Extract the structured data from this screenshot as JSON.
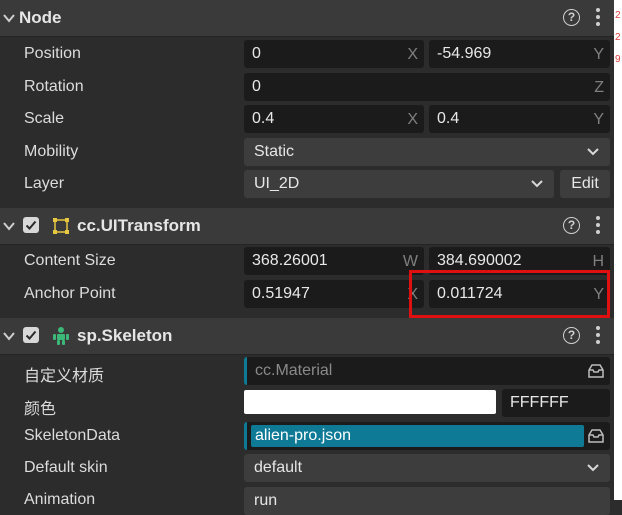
{
  "node": {
    "title": "Node",
    "rows": {
      "position": {
        "label": "Position",
        "x": "0",
        "x_axis": "X",
        "y": "-54.969",
        "y_axis": "Y"
      },
      "rotation": {
        "label": "Rotation",
        "value": "0",
        "axis": "Z"
      },
      "scale": {
        "label": "Scale",
        "x": "0.4",
        "x_axis": "X",
        "y": "0.4",
        "y_axis": "Y"
      },
      "mobility": {
        "label": "Mobility",
        "value": "Static"
      },
      "layer": {
        "label": "Layer",
        "value": "UI_2D",
        "edit_label": "Edit"
      }
    }
  },
  "uitransform": {
    "title": "cc.UITransform",
    "enabled": true,
    "rows": {
      "content_size": {
        "label": "Content Size",
        "w": "368.26001",
        "w_axis": "W",
        "h": "384.690002",
        "h_axis": "H"
      },
      "anchor_point": {
        "label": "Anchor Point",
        "x": "0.51947",
        "x_axis": "X",
        "y": "0.011724",
        "y_axis": "Y"
      }
    }
  },
  "skeleton": {
    "title": "sp.Skeleton",
    "enabled": true,
    "rows": {
      "material": {
        "label": "自定义材质",
        "placeholder": "cc.Material"
      },
      "color": {
        "label": "颜色",
        "hex": "FFFFFF",
        "swatch": "#ffffff"
      },
      "skeleton_data": {
        "label": "SkeletonData",
        "value": "alien-pro.json"
      },
      "default_skin": {
        "label": "Default skin",
        "value": "default"
      },
      "animation": {
        "label": "Animation",
        "value": "run"
      }
    }
  },
  "right_strip": {
    "chars": [
      "2",
      "2",
      "9"
    ]
  },
  "colors": {
    "panel": "#2c2c2c",
    "header": "#3a3a3a",
    "field": "#1b1b1b",
    "asset_accent": "#0e7a96",
    "highlight": "#e01010",
    "component_icon": "#e8c840",
    "skeleton_icon": "#3cb878"
  }
}
